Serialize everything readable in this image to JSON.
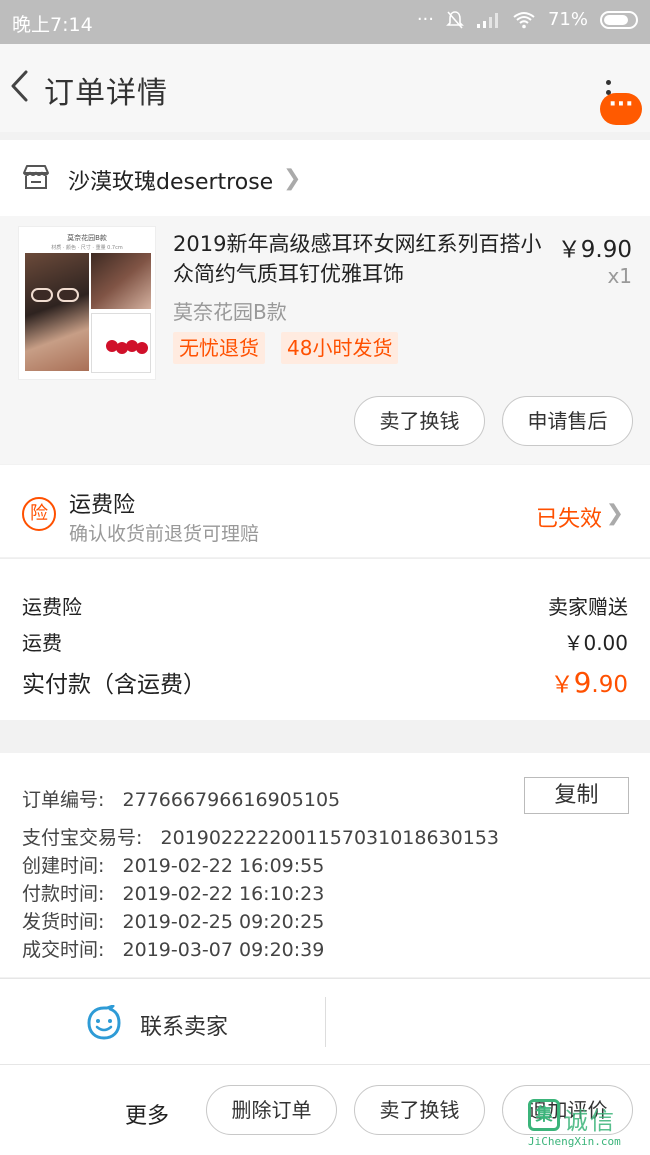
{
  "status_bar": {
    "time": "晚上7:14",
    "battery": "71%"
  },
  "nav": {
    "title": "订单详情",
    "more_badge": "···"
  },
  "shop": {
    "name": "沙漠玫瑰desertrose"
  },
  "goods": {
    "thumb_caption": "莫奈花园B款",
    "thumb_sub": "材质 · 颜色 · 尺寸 · 重量 0.7cm",
    "title": "2019新年高级感耳环女网红系列百搭小众简约气质耳钉优雅耳饰",
    "price": "￥9.90",
    "qty": "x1",
    "sku": "莫奈花园B款",
    "tags": [
      "无忧退货",
      "48小时发货"
    ],
    "actions": [
      "卖了换钱",
      "申请售后"
    ]
  },
  "insurance": {
    "icon_text": "险",
    "title": "运费险",
    "subtitle": "确认收货前退货可理赔",
    "status": "已失效"
  },
  "fees": [
    {
      "label": "运费险",
      "value": "卖家赠送"
    },
    {
      "label": "运费",
      "value": "￥0.00"
    }
  ],
  "payment": {
    "label": "实付款（含运费）",
    "currency": "￥",
    "integer": "9",
    "decimal": ".90"
  },
  "order_info": {
    "copy_label": "复制",
    "lines": [
      {
        "label": "订单编号:",
        "value": "277666796616905105"
      },
      {
        "label": "支付宝交易号:",
        "value": "2019022222001157031018630153"
      },
      {
        "label": "创建时间:",
        "value": "2019-02-22 16:09:55"
      },
      {
        "label": "付款时间:",
        "value": "2019-02-22 16:10:23"
      },
      {
        "label": "发货时间:",
        "value": "2019-02-25 09:20:25"
      },
      {
        "label": "成交时间:",
        "value": "2019-03-07 09:20:39"
      }
    ]
  },
  "contact": {
    "label": "联系卖家"
  },
  "bottom": {
    "more_label": "更多",
    "buttons": [
      "删除订单",
      "卖了换钱",
      "追加评价"
    ]
  },
  "watermark": {
    "badge": "集",
    "text": "诚信",
    "url": "JiChengXin.com"
  },
  "colors": {
    "accent": "#ff5000",
    "contact_icon": "#2e9bd6",
    "watermark": "#3bb47a"
  }
}
